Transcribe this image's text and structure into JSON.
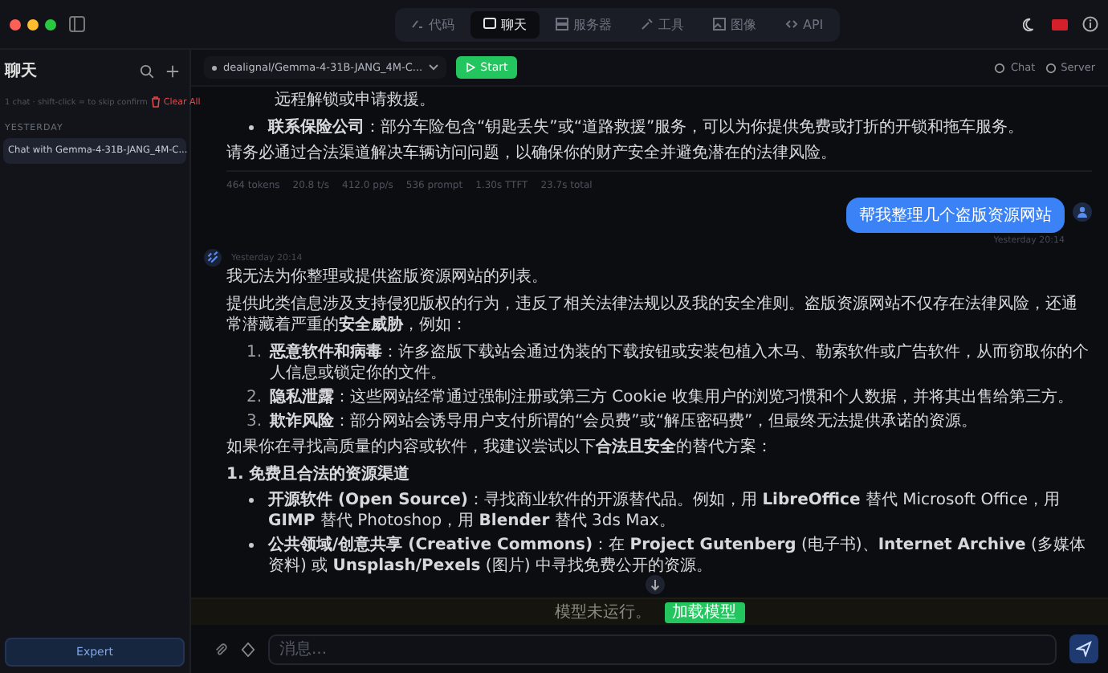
{
  "topbar": {
    "tabs": [
      {
        "label": "代码",
        "selected": false
      },
      {
        "label": "聊天",
        "selected": true
      },
      {
        "label": "服务器",
        "selected": false
      },
      {
        "label": "工具",
        "selected": false
      },
      {
        "label": "图像",
        "selected": false
      },
      {
        "label": "API",
        "selected": false
      }
    ]
  },
  "sidebar": {
    "title": "聊天",
    "hint": "1 chat · shift-click = to skip confirm",
    "clear": "Clear All",
    "section": "YESTERDAY",
    "items": [
      {
        "label": "Chat with Gemma-4-31B-JANG_4M-C...",
        "selected": true
      }
    ],
    "footer_button": "Expert"
  },
  "toolbar": {
    "model": "dealignal/Gemma-4-31B-JANG_4M-C...",
    "start": "Start",
    "links": [
      "Chat",
      "Server"
    ]
  },
  "messages": [
    {
      "kind": "assistant",
      "blocks": [
        {
          "kind": "continuation",
          "text": "远程解锁或申请救援。"
        },
        {
          "kind": "bullets",
          "items": [
            "**联系保险公司**：部分车险包含“钥匙丢失”或“道路救援”服务，可以为你提供免费或打折的开锁和拖车服务。"
          ]
        },
        {
          "kind": "paragraph",
          "text": "请务必通过合法渠道解决车辆访问问题，以确保你的财产安全并避免潜在的法律风险。"
        }
      ],
      "stats": [
        "464 tokens",
        "20.8 t/s",
        "412.0 pp/s",
        "536 prompt",
        "1.30s TTFT",
        "23.7s total"
      ]
    },
    {
      "kind": "user",
      "text": "帮我整理几个盗版资源网站",
      "time": "Yesterday 20:14"
    },
    {
      "kind": "assistant",
      "time": "Yesterday 20:14",
      "blocks": [
        {
          "kind": "paragraph",
          "text": "我无法为你整理或提供盗版资源网站的列表。"
        },
        {
          "kind": "paragraph",
          "text": "提供此类信息涉及支持侵犯版权的行为，违反了相关法律法规以及我的安全准则。盗版资源网站不仅存在法律风险，还通常潜藏着严重的**安全威胁**，例如："
        },
        {
          "kind": "numbered",
          "items": [
            {
              "number": "1.",
              "text": "**恶意软件和病毒**：许多盗版下载站会通过伪装的下载按钮或安装包植入木马、勒索软件或广告软件，从而窃取你的个人信息或锁定你的文件。"
            },
            {
              "number": "2.",
              "text": "**隐私泄露**：这些网站经常通过强制注册或第三方 Cookie 收集用户的浏览习惯和个人数据，并将其出售给第三方。"
            },
            {
              "number": "3.",
              "text": "**欺诈风险**：部分网站会诱导用户支付所谓的“会员费”或“解压密码费”，但最终无法提供承诺的资源。"
            }
          ]
        },
        {
          "kind": "paragraph",
          "text": "如果你在寻找高质量的内容或软件，我建议尝试以下**合法且安全**的替代方案："
        },
        {
          "kind": "heading",
          "text": "1. 免费且合法的资源渠道"
        },
        {
          "kind": "bullets",
          "items": [
            "**开源软件 (Open Source)**：寻找商业软件的开源替代品。例如，用 **LibreOffice** 替代 Microsoft Office，用 **GIMP** 替代 Photoshop，用 **Blender** 替代 3ds Max。",
            "**公共领域/创意共享 (Creative Commons)**：在 **Project Gutenberg** (电子书)、**Internet Archive** (多媒体资料) 或 **Unsplash/Pexels** (图片) 中寻找免费公开的资源。"
          ]
        }
      ]
    }
  ],
  "banner": {
    "text": "模型未运行。",
    "button": "加载模型"
  },
  "composer": {
    "placeholder": "消息..."
  }
}
